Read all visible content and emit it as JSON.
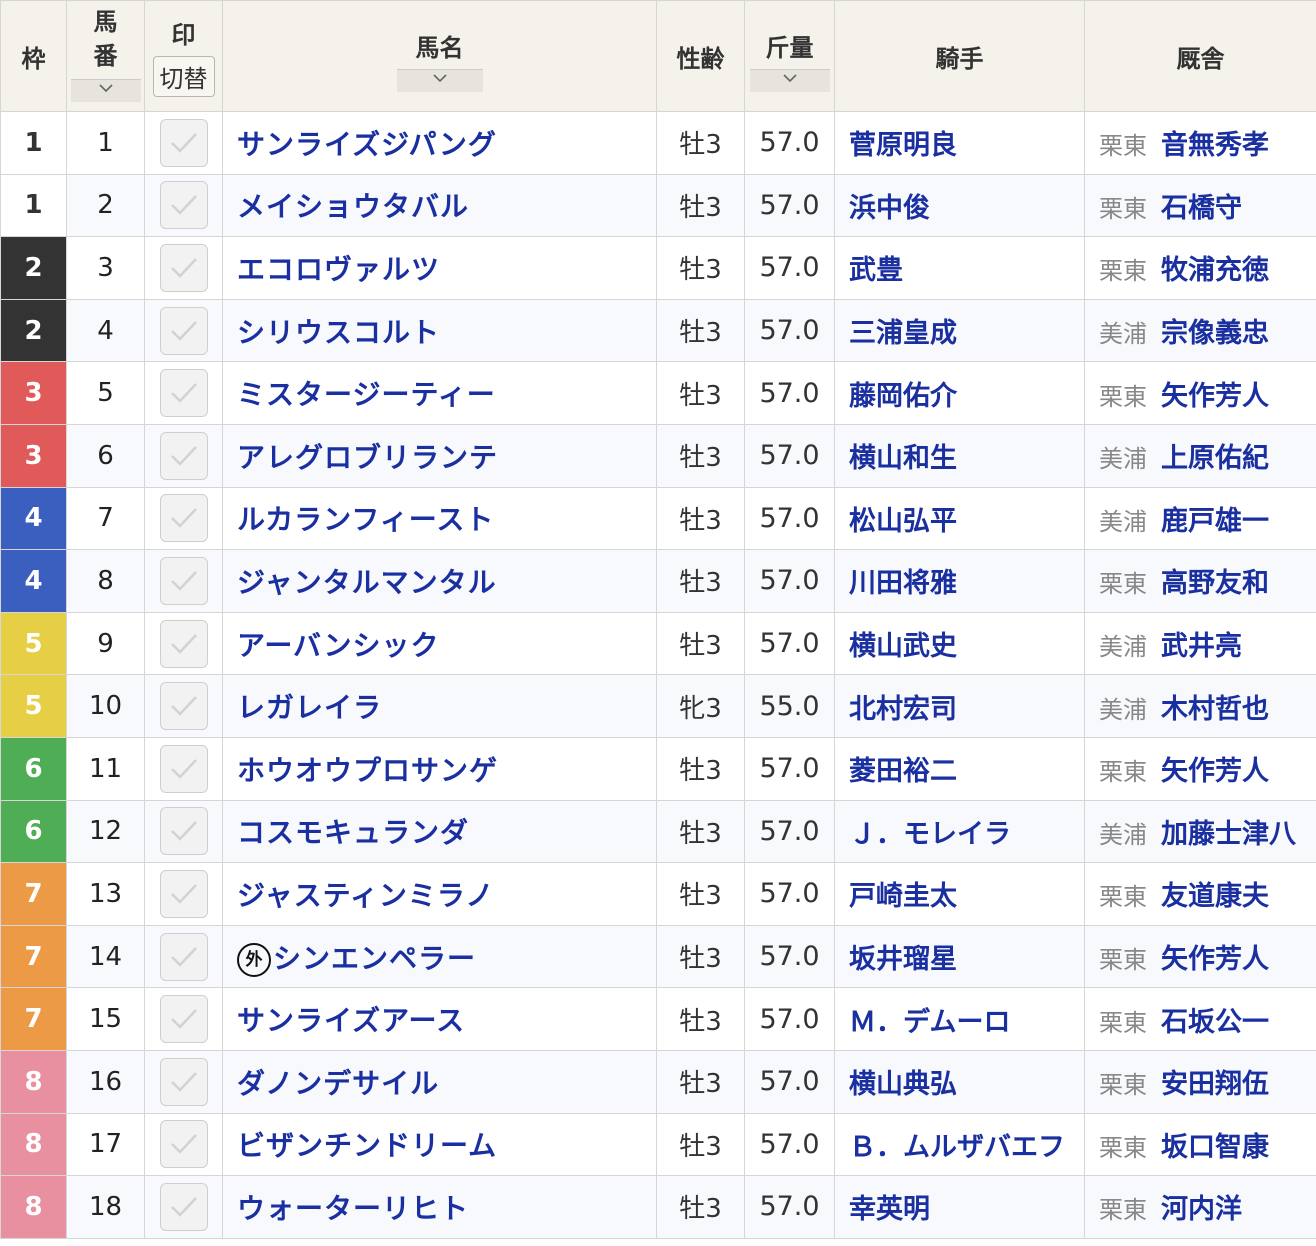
{
  "header": {
    "waku": "枠",
    "umaban_line1": "馬",
    "umaban_line2": "番",
    "mark": "印",
    "switch": "切替",
    "horse_name": "馬名",
    "sex_age": "性齢",
    "weight": "斤量",
    "jockey": "騎手",
    "stable": "厩舎"
  },
  "waku_colors": {
    "1": {
      "bg": "#ffffff",
      "fg": "#333333"
    },
    "2": {
      "bg": "#333333",
      "fg": "#ffffff"
    },
    "3": {
      "bg": "#e05a5a",
      "fg": "#ffffff"
    },
    "4": {
      "bg": "#3a5fbf",
      "fg": "#ffffff"
    },
    "5": {
      "bg": "#e6cf45",
      "fg": "#ffffff"
    },
    "6": {
      "bg": "#4fae55",
      "fg": "#ffffff"
    },
    "7": {
      "bg": "#ec9a45",
      "fg": "#ffffff"
    },
    "8": {
      "bg": "#e88fa0",
      "fg": "#ffffff"
    }
  },
  "rows": [
    {
      "waku": "1",
      "umaban": "1",
      "name": "サンライズジパング",
      "gai": "",
      "sex_age": "牡3",
      "weight": "57.0",
      "jockey": "菅原明良",
      "region": "栗東",
      "trainer": "音無秀孝"
    },
    {
      "waku": "1",
      "umaban": "2",
      "name": "メイショウタバル",
      "gai": "",
      "sex_age": "牡3",
      "weight": "57.0",
      "jockey": "浜中俊",
      "region": "栗東",
      "trainer": "石橋守"
    },
    {
      "waku": "2",
      "umaban": "3",
      "name": "エコロヴァルツ",
      "gai": "",
      "sex_age": "牡3",
      "weight": "57.0",
      "jockey": "武豊",
      "region": "栗東",
      "trainer": "牧浦充徳"
    },
    {
      "waku": "2",
      "umaban": "4",
      "name": "シリウスコルト",
      "gai": "",
      "sex_age": "牡3",
      "weight": "57.0",
      "jockey": "三浦皇成",
      "region": "美浦",
      "trainer": "宗像義忠"
    },
    {
      "waku": "3",
      "umaban": "5",
      "name": "ミスタージーティー",
      "gai": "",
      "sex_age": "牡3",
      "weight": "57.0",
      "jockey": "藤岡佑介",
      "region": "栗東",
      "trainer": "矢作芳人"
    },
    {
      "waku": "3",
      "umaban": "6",
      "name": "アレグロブリランテ",
      "gai": "",
      "sex_age": "牡3",
      "weight": "57.0",
      "jockey": "横山和生",
      "region": "美浦",
      "trainer": "上原佑紀"
    },
    {
      "waku": "4",
      "umaban": "7",
      "name": "ルカランフィースト",
      "gai": "",
      "sex_age": "牡3",
      "weight": "57.0",
      "jockey": "松山弘平",
      "region": "美浦",
      "trainer": "鹿戸雄一"
    },
    {
      "waku": "4",
      "umaban": "8",
      "name": "ジャンタルマンタル",
      "gai": "",
      "sex_age": "牡3",
      "weight": "57.0",
      "jockey": "川田将雅",
      "region": "栗東",
      "trainer": "高野友和"
    },
    {
      "waku": "5",
      "umaban": "9",
      "name": "アーバンシック",
      "gai": "",
      "sex_age": "牡3",
      "weight": "57.0",
      "jockey": "横山武史",
      "region": "美浦",
      "trainer": "武井亮"
    },
    {
      "waku": "5",
      "umaban": "10",
      "name": "レガレイラ",
      "gai": "",
      "sex_age": "牝3",
      "weight": "55.0",
      "jockey": "北村宏司",
      "region": "美浦",
      "trainer": "木村哲也"
    },
    {
      "waku": "6",
      "umaban": "11",
      "name": "ホウオウプロサンゲ",
      "gai": "",
      "sex_age": "牡3",
      "weight": "57.0",
      "jockey": "菱田裕二",
      "region": "栗東",
      "trainer": "矢作芳人"
    },
    {
      "waku": "6",
      "umaban": "12",
      "name": "コスモキュランダ",
      "gai": "",
      "sex_age": "牡3",
      "weight": "57.0",
      "jockey": "Ｊ．モレイラ",
      "region": "美浦",
      "trainer": "加藤士津八"
    },
    {
      "waku": "7",
      "umaban": "13",
      "name": "ジャスティンミラノ",
      "gai": "",
      "sex_age": "牡3",
      "weight": "57.0",
      "jockey": "戸崎圭太",
      "region": "栗東",
      "trainer": "友道康夫"
    },
    {
      "waku": "7",
      "umaban": "14",
      "name": "シンエンペラー",
      "gai": "外",
      "sex_age": "牡3",
      "weight": "57.0",
      "jockey": "坂井瑠星",
      "region": "栗東",
      "trainer": "矢作芳人"
    },
    {
      "waku": "7",
      "umaban": "15",
      "name": "サンライズアース",
      "gai": "",
      "sex_age": "牡3",
      "weight": "57.0",
      "jockey": "Ｍ．デムーロ",
      "region": "栗東",
      "trainer": "石坂公一"
    },
    {
      "waku": "8",
      "umaban": "16",
      "name": "ダノンデサイル",
      "gai": "",
      "sex_age": "牡3",
      "weight": "57.0",
      "jockey": "横山典弘",
      "region": "栗東",
      "trainer": "安田翔伍"
    },
    {
      "waku": "8",
      "umaban": "17",
      "name": "ビザンチンドリーム",
      "gai": "",
      "sex_age": "牡3",
      "weight": "57.0",
      "jockey": "Ｂ．ムルザバエフ",
      "region": "栗東",
      "trainer": "坂口智康"
    },
    {
      "waku": "8",
      "umaban": "18",
      "name": "ウォーターリヒト",
      "gai": "",
      "sex_age": "牡3",
      "weight": "57.0",
      "jockey": "幸英明",
      "region": "栗東",
      "trainer": "河内洋"
    }
  ]
}
